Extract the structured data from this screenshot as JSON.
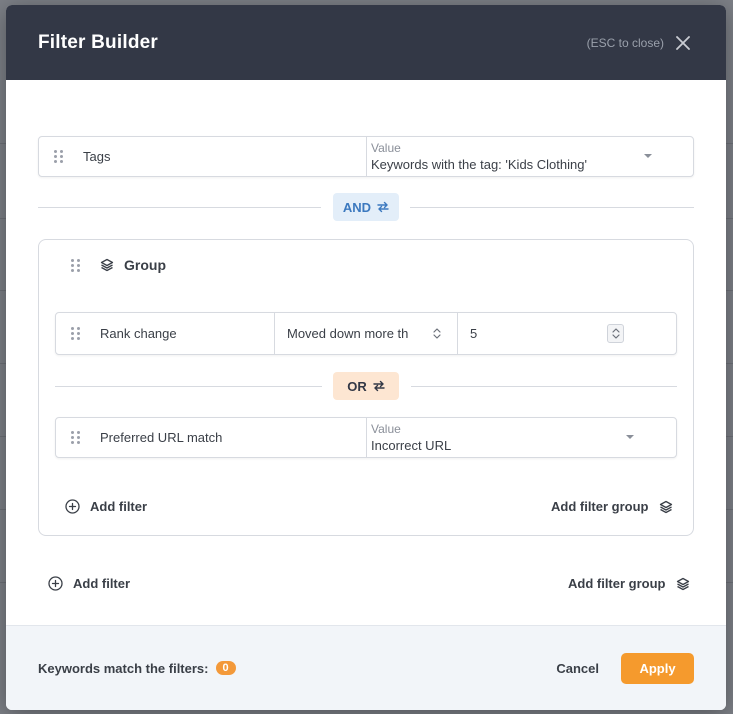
{
  "modal": {
    "title": "Filter Builder",
    "esc_hint": "(ESC to close)"
  },
  "filters": {
    "tags": {
      "field": "Tags",
      "value_label": "Value",
      "value": "Keywords with the tag: 'Kids Clothing'"
    },
    "and_operator": "AND",
    "group": {
      "title": "Group",
      "rank_change": {
        "field": "Rank change",
        "condition": "Moved down more th",
        "number": "5"
      },
      "or_operator": "OR",
      "preferred_url": {
        "field": "Preferred URL match",
        "value_label": "Value",
        "value": "Incorrect URL"
      },
      "add_filter": "Add filter",
      "add_filter_group": "Add filter group"
    },
    "add_filter": "Add filter",
    "add_filter_group": "Add filter group"
  },
  "footer": {
    "match_label": "Keywords match the filters:",
    "match_count": "0",
    "cancel": "Cancel",
    "apply": "Apply"
  },
  "colors": {
    "header_bg": "#333846",
    "accent": "#f59a2d",
    "and_badge_bg": "#e3eef9",
    "or_badge_bg": "#fde6d2"
  }
}
